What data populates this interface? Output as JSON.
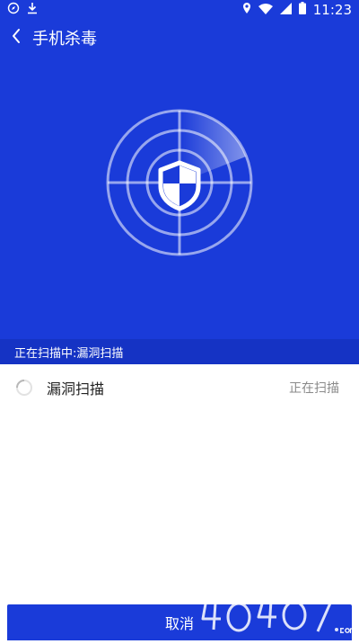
{
  "status_bar": {
    "time": "11:23",
    "left_icons": [
      "compass-icon",
      "download-icon"
    ],
    "right_icons": [
      "location-icon",
      "wifi-icon",
      "signal-icon",
      "battery-icon"
    ]
  },
  "header": {
    "title": "手机杀毒",
    "back_icon": "chevron-left-icon"
  },
  "hero": {
    "radar_icon": "radar-icon",
    "shield_icon": "shield-icon"
  },
  "scan": {
    "status_text": "正在扫描中:漏洞扫描",
    "items": [
      {
        "label": "漏洞扫描",
        "status": "正在扫描",
        "icon": "spinner-icon"
      }
    ]
  },
  "actions": {
    "cancel_label": "取消"
  },
  "watermark": {
    "text": "4O4O7.com"
  },
  "colors": {
    "brand_blue": "#1a3bd9",
    "status_strip": "#1533c4",
    "text_primary": "#222222",
    "text_secondary": "#8a8a8a"
  }
}
